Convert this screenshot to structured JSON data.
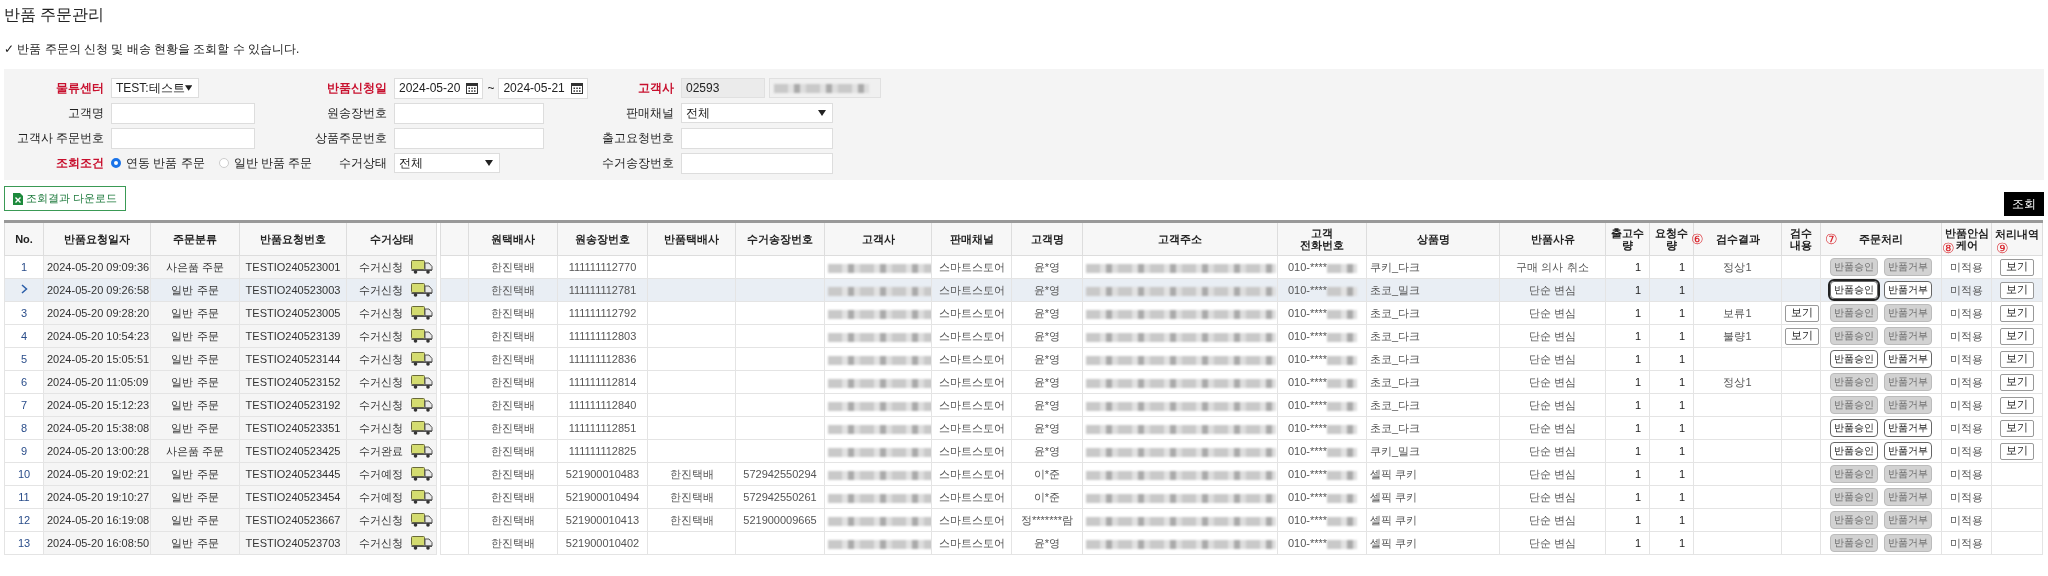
{
  "page": {
    "title": "반품 주문관리",
    "description": "✓ 반품 주문의 신청 및 배송 현황을 조회할 수 있습니다."
  },
  "filters": [
    {
      "kind": "select",
      "label": "물류센터",
      "required": true,
      "value": "TEST:테스트"
    },
    {
      "kind": "daterange",
      "label": "반품신청일",
      "required": true,
      "from": "2024-05-20",
      "separator": "~",
      "to": "2024-05-21"
    },
    {
      "kind": "code",
      "label": "고객사",
      "required": true,
      "value": "02593"
    },
    {
      "kind": "text",
      "label": "고객명",
      "required": false
    },
    {
      "kind": "text",
      "label": "원송장번호",
      "required": false
    },
    {
      "kind": "select",
      "label": "판매채널",
      "required": false,
      "value": "전체"
    },
    {
      "kind": "text",
      "label": "고객사 주문번호",
      "required": false
    },
    {
      "kind": "text",
      "label": "상품주문번호",
      "required": false
    },
    {
      "kind": "text",
      "label": "출고요청번호",
      "required": false
    },
    {
      "kind": "radio",
      "label": "조회조건",
      "required": true,
      "options": [
        {
          "label": "연동 반품 주문",
          "selected": true
        },
        {
          "label": "일반 반품 주문",
          "selected": false
        }
      ]
    },
    {
      "kind": "select",
      "label": "수거상태",
      "required": false,
      "value": "전체"
    },
    {
      "kind": "text",
      "label": "수거송장번호",
      "required": false
    }
  ],
  "download_button": {
    "label": "조회결과 다운로드"
  },
  "search_button": {
    "label": "조회"
  },
  "table": {
    "columns": [
      {
        "label": "No."
      },
      {
        "label": "반품요청일자"
      },
      {
        "label": "주문분류"
      },
      {
        "label": "반품요청번호"
      },
      {
        "label": "수거상태"
      },
      {
        "label": "원택배사"
      },
      {
        "label": "원송장번호"
      },
      {
        "label": "반품택배사"
      },
      {
        "label": "수거송장번호"
      },
      {
        "label": "고객사"
      },
      {
        "label": "판매채널"
      },
      {
        "label": "고객명"
      },
      {
        "label": "고객주소"
      },
      {
        "label": "고객\n전화번호"
      },
      {
        "label": "상품명"
      },
      {
        "label": "반품사유"
      },
      {
        "label": "출고수량"
      },
      {
        "label": "요청수량"
      },
      {
        "label": "검수결과",
        "marker": "⑥"
      },
      {
        "label": "검수\n내용"
      },
      {
        "label": "주문처리",
        "marker": "⑦"
      },
      {
        "label": "반품안심\n케어",
        "marker": "⑧"
      },
      {
        "label": "처리내역",
        "marker": "⑨"
      }
    ],
    "rows": [
      {
        "no": "1",
        "selected": false,
        "date": "2024-05-20 09:09:36",
        "type": "사은품 주문",
        "request_no": "TESTIO240523001",
        "status": "수거신청",
        "carrier": "한진택배",
        "invoice": "111111112770",
        "channel": "스마트스토어",
        "customer_name": "윤*영",
        "phone": "010-****",
        "product": "쿠키_다크",
        "reason": "구매 의사 취소",
        "out_qty": "1",
        "req_qty": "1",
        "inspection": "정상1",
        "approve": {
          "label": "반품승인",
          "disabled": true,
          "focused": false
        },
        "reject": {
          "label": "반품거부",
          "disabled": true
        },
        "care": "미적용",
        "history": "보기"
      },
      {
        "selected": true,
        "date": "2024-05-20 09:26:58",
        "type": "일반 주문",
        "request_no": "TESTIO240523003",
        "status": "수거신청",
        "carrier": "한진택배",
        "invoice": "111111112781",
        "channel": "스마트스토어",
        "customer_name": "윤*영",
        "phone": "010-****",
        "product": "초코_밀크",
        "reason": "단순 변심",
        "out_qty": "1",
        "req_qty": "1",
        "approve": {
          "label": "반품승인",
          "disabled": false,
          "focused": true
        },
        "reject": {
          "label": "반품거부",
          "disabled": false
        },
        "care": "미적용",
        "history": "보기"
      },
      {
        "no": "3",
        "selected": false,
        "date": "2024-05-20 09:28:20",
        "type": "일반 주문",
        "request_no": "TESTIO240523005",
        "status": "수거신청",
        "carrier": "한진택배",
        "invoice": "111111112792",
        "channel": "스마트스토어",
        "customer_name": "윤*영",
        "phone": "010-****",
        "product": "초코_다크",
        "reason": "단순 변심",
        "out_qty": "1",
        "req_qty": "1",
        "inspection": "보류1",
        "inspection_view": "보기",
        "approve": {
          "label": "반품승인",
          "disabled": true,
          "focused": false
        },
        "reject": {
          "label": "반품거부",
          "disabled": true
        },
        "care": "미적용",
        "history": "보기"
      },
      {
        "no": "4",
        "selected": false,
        "date": "2024-05-20 10:54:23",
        "type": "일반 주문",
        "request_no": "TESTIO240523139",
        "status": "수거신청",
        "carrier": "한진택배",
        "invoice": "111111112803",
        "channel": "스마트스토어",
        "customer_name": "윤*영",
        "phone": "010-****",
        "product": "초코_다크",
        "reason": "단순 변심",
        "out_qty": "1",
        "req_qty": "1",
        "inspection": "불량1",
        "inspection_view": "보기",
        "approve": {
          "label": "반품승인",
          "disabled": true,
          "focused": false
        },
        "reject": {
          "label": "반품거부",
          "disabled": true
        },
        "care": "미적용",
        "history": "보기"
      },
      {
        "no": "5",
        "selected": false,
        "date": "2024-05-20 15:05:51",
        "type": "일반 주문",
        "request_no": "TESTIO240523144",
        "status": "수거신청",
        "carrier": "한진택배",
        "invoice": "111111112836",
        "channel": "스마트스토어",
        "customer_name": "윤*영",
        "phone": "010-****",
        "product": "초코_다크",
        "reason": "단순 변심",
        "out_qty": "1",
        "req_qty": "1",
        "approve": {
          "label": "반품승인",
          "disabled": false,
          "focused": false
        },
        "reject": {
          "label": "반품거부",
          "disabled": false
        },
        "care": "미적용",
        "history": "보기"
      },
      {
        "no": "6",
        "selected": false,
        "date": "2024-05-20 11:05:09",
        "type": "일반 주문",
        "request_no": "TESTIO240523152",
        "status": "수거신청",
        "carrier": "한진택배",
        "invoice": "111111112814",
        "channel": "스마트스토어",
        "customer_name": "윤*영",
        "phone": "010-****",
        "product": "초코_다크",
        "reason": "단순 변심",
        "out_qty": "1",
        "req_qty": "1",
        "inspection": "정상1",
        "approve": {
          "label": "반품승인",
          "disabled": true,
          "focused": false
        },
        "reject": {
          "label": "반품거부",
          "disabled": true
        },
        "care": "미적용",
        "history": "보기"
      },
      {
        "no": "7",
        "selected": false,
        "date": "2024-05-20 15:12:23",
        "type": "일반 주문",
        "request_no": "TESTIO240523192",
        "status": "수거신청",
        "carrier": "한진택배",
        "invoice": "111111112840",
        "channel": "스마트스토어",
        "customer_name": "윤*영",
        "phone": "010-****",
        "product": "초코_다크",
        "reason": "단순 변심",
        "out_qty": "1",
        "req_qty": "1",
        "approve": {
          "label": "반품승인",
          "disabled": true,
          "focused": false
        },
        "reject": {
          "label": "반품거부",
          "disabled": true
        },
        "care": "미적용",
        "history": "보기"
      },
      {
        "no": "8",
        "selected": false,
        "date": "2024-05-20 15:38:08",
        "type": "일반 주문",
        "request_no": "TESTIO240523351",
        "status": "수거신청",
        "carrier": "한진택배",
        "invoice": "111111112851",
        "channel": "스마트스토어",
        "customer_name": "윤*영",
        "phone": "010-****",
        "product": "초코_다크",
        "reason": "단순 변심",
        "out_qty": "1",
        "req_qty": "1",
        "approve": {
          "label": "반품승인",
          "disabled": false,
          "focused": false
        },
        "reject": {
          "label": "반품거부",
          "disabled": false
        },
        "care": "미적용",
        "history": "보기"
      },
      {
        "no": "9",
        "selected": false,
        "date": "2024-05-20 13:00:28",
        "type": "사은품 주문",
        "request_no": "TESTIO240523425",
        "status": "수거완료",
        "carrier": "한진택배",
        "invoice": "111111112825",
        "channel": "스마트스토어",
        "customer_name": "윤*영",
        "phone": "010-****",
        "product": "쿠키_밀크",
        "reason": "단순 변심",
        "out_qty": "1",
        "req_qty": "1",
        "approve": {
          "label": "반품승인",
          "disabled": false,
          "focused": false
        },
        "reject": {
          "label": "반품거부",
          "disabled": false
        },
        "care": "미적용",
        "history": "보기"
      },
      {
        "no": "10",
        "selected": false,
        "date": "2024-05-20 19:02:21",
        "type": "일반 주문",
        "request_no": "TESTIO240523445",
        "status": "수거예정",
        "carrier": "한진택배",
        "invoice": "521900010483",
        "return_carrier": "한진택배",
        "pickup_invoice": "572942550294",
        "channel": "스마트스토어",
        "customer_name": "이*준",
        "phone": "010-****",
        "product": "셀픽 쿠키",
        "reason": "단순 변심",
        "out_qty": "1",
        "req_qty": "1",
        "approve": {
          "label": "반품승인",
          "disabled": true,
          "focused": false
        },
        "reject": {
          "label": "반품거부",
          "disabled": true
        },
        "care": "미적용"
      },
      {
        "no": "11",
        "selected": false,
        "date": "2024-05-20 19:10:27",
        "type": "일반 주문",
        "request_no": "TESTIO240523454",
        "status": "수거예정",
        "carrier": "한진택배",
        "invoice": "521900010494",
        "return_carrier": "한진택배",
        "pickup_invoice": "572942550261",
        "channel": "스마트스토어",
        "customer_name": "이*준",
        "phone": "010-****",
        "product": "셀픽 쿠키",
        "reason": "단순 변심",
        "out_qty": "1",
        "req_qty": "1",
        "approve": {
          "label": "반품승인",
          "disabled": true,
          "focused": false
        },
        "reject": {
          "label": "반품거부",
          "disabled": true
        },
        "care": "미적용"
      },
      {
        "no": "12",
        "selected": false,
        "date": "2024-05-20 16:19:08",
        "type": "일반 주문",
        "request_no": "TESTIO240523667",
        "status": "수거신청",
        "carrier": "한진택배",
        "invoice": "521900010413",
        "return_carrier": "한진택배",
        "pickup_invoice": "521900009665",
        "channel": "스마트스토어",
        "customer_name": "정*******람",
        "phone": "010-****",
        "product": "셀픽 쿠키",
        "reason": "단순 변심",
        "out_qty": "1",
        "req_qty": "1",
        "approve": {
          "label": "반품승인",
          "disabled": true,
          "focused": false
        },
        "reject": {
          "label": "반품거부",
          "disabled": true
        },
        "care": "미적용"
      },
      {
        "no": "13",
        "selected": false,
        "date": "2024-05-20 16:08:50",
        "type": "일반 주문",
        "request_no": "TESTIO240523703",
        "status": "수거신청",
        "carrier": "한진택배",
        "invoice": "521900010402",
        "channel": "스마트스토어",
        "customer_name": "윤*영",
        "phone": "010-****",
        "product": "셀픽 쿠키",
        "reason": "단순 변심",
        "out_qty": "1",
        "req_qty": "1",
        "approve": {
          "label": "반품승인",
          "disabled": true,
          "focused": false
        },
        "reject": {
          "label": "반품거부",
          "disabled": true
        },
        "care": "미적용"
      }
    ]
  }
}
